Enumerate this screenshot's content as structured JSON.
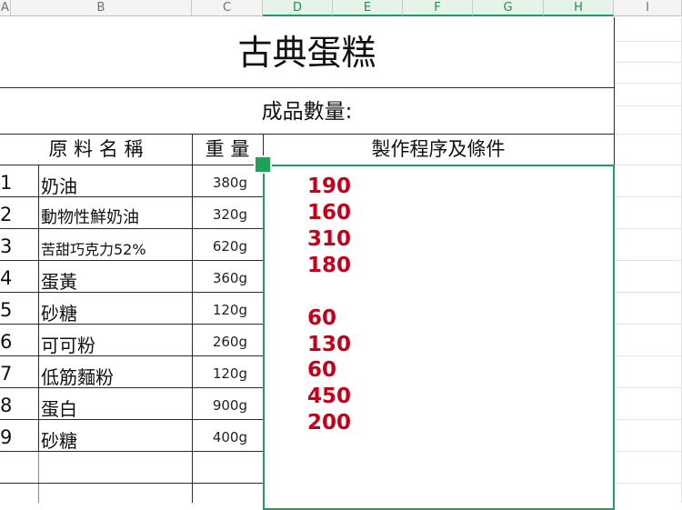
{
  "app": {
    "accent_color": "#1fa05b",
    "value_color": "#c4001a"
  },
  "columns": [
    "A",
    "B",
    "C",
    "D",
    "E",
    "F",
    "G",
    "H",
    "I"
  ],
  "sheet": {
    "title": "古典蛋糕",
    "subtitle": "成品數量:",
    "headers": {
      "ingredient": "原 料 名 稱",
      "weight": "重 量",
      "procedure": "製作程序及條件"
    },
    "rows": [
      {
        "num": "1",
        "name": "奶油",
        "weight": "380g"
      },
      {
        "num": "2",
        "name": "動物性鮮奶油",
        "weight": "320g"
      },
      {
        "num": "3",
        "name": "苦甜巧克力52%",
        "weight": "620g"
      },
      {
        "num": "4",
        "name": "蛋黃",
        "weight": "360g"
      },
      {
        "num": "5",
        "name": "砂糖",
        "weight": "120g"
      },
      {
        "num": "6",
        "name": "可可粉",
        "weight": "260g"
      },
      {
        "num": "7",
        "name": "低筋麵粉",
        "weight": "120g"
      },
      {
        "num": "8",
        "name": "蛋白",
        "weight": "900g"
      },
      {
        "num": "9",
        "name": "砂糖",
        "weight": "400g"
      }
    ],
    "procedure_values": [
      "190",
      "160",
      "310",
      "180",
      "60",
      "130",
      "60",
      "450",
      "200"
    ]
  }
}
